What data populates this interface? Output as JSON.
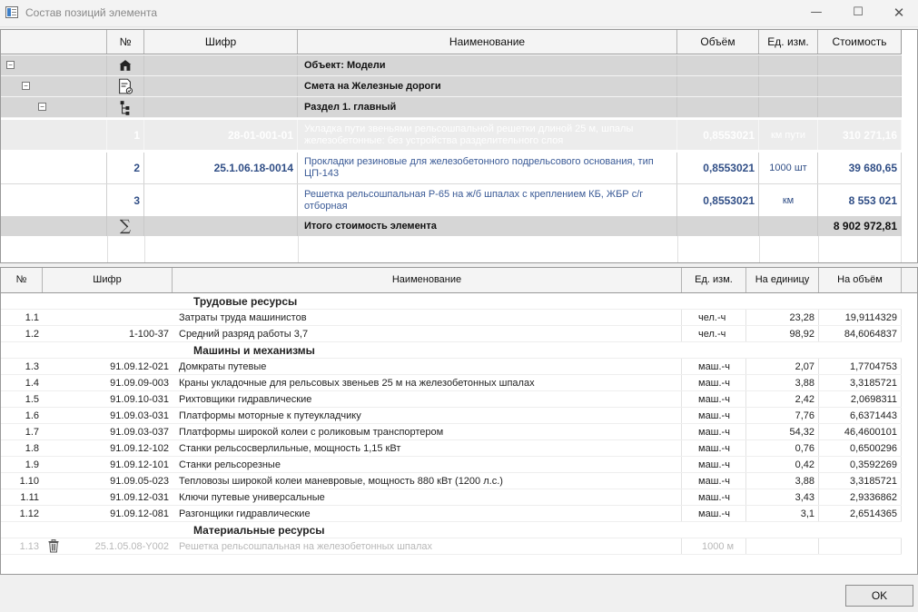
{
  "window": {
    "title": "Состав позиций элемента",
    "minimize": "—",
    "maximize": "☐",
    "close": "✕"
  },
  "top_grid": {
    "headers": [
      "№",
      "Шифр",
      "Наименование",
      "Объём",
      "Ед. изм.",
      "Стоимость"
    ],
    "tree": [
      {
        "name": "Объект: Модели",
        "icon": "building-icon"
      },
      {
        "name": "Смета на Железные дороги",
        "icon": "estimate-document-icon"
      },
      {
        "name": "Раздел 1. главный",
        "icon": "section-tree-icon"
      }
    ],
    "positions": [
      {
        "num": "1",
        "code": "28-01-001-01",
        "name": "Укладка пути звеньями рельсошпальной решетки длиной 25 м, шпалы железобетонные: без устройства разделительного слоя",
        "volume": "0,8553021",
        "unit": "км пути",
        "cost": "310 271,16",
        "state": "faded"
      },
      {
        "num": "2",
        "code": "25.1.06.18-0014",
        "name": "Прокладки резиновые для железобетонного подрельсового основания, тип ЦП-143",
        "volume": "0,8553021",
        "unit": "1000 шт",
        "cost": "39 680,65",
        "state": "normal"
      },
      {
        "num": "3",
        "code": "",
        "name": "Решетка рельсошпальная Р-65 на ж/б шпалах с креплением КБ, ЖБР с/г отборная",
        "volume": "0,8553021",
        "unit": "км",
        "cost": "8 553 021",
        "state": "normal"
      }
    ],
    "total": {
      "symbol": "∑",
      "name": "Итого стоимость элемента",
      "cost": "8 902 972,81"
    },
    "toggle_symbol": "−"
  },
  "bottom_grid": {
    "headers": [
      "№",
      "Шифр",
      "Наименование",
      "Ед. изм.",
      "На единицу",
      "На объём"
    ],
    "rows": [
      {
        "type": "group",
        "name": "Трудовые ресурсы"
      },
      {
        "type": "item",
        "num": "1.1",
        "code": "",
        "name": "Затраты труда машинистов",
        "unit": "чел.-ч",
        "per_unit": "23,28",
        "per_volume": "19,9114329"
      },
      {
        "type": "item",
        "num": "1.2",
        "code": "1-100-37",
        "name": "Средний разряд работы 3,7",
        "unit": "чел.-ч",
        "per_unit": "98,92",
        "per_volume": "84,6064837"
      },
      {
        "type": "group",
        "name": "Машины и механизмы"
      },
      {
        "type": "item",
        "num": "1.3",
        "code": "91.09.12-021",
        "name": "Домкраты путевые",
        "unit": "маш.-ч",
        "per_unit": "2,07",
        "per_volume": "1,7704753"
      },
      {
        "type": "item",
        "num": "1.4",
        "code": "91.09.09-003",
        "name": "Краны укладочные для рельсовых звеньев 25 м на железобетонных шпалах",
        "unit": "маш.-ч",
        "per_unit": "3,88",
        "per_volume": "3,3185721"
      },
      {
        "type": "item",
        "num": "1.5",
        "code": "91.09.10-031",
        "name": "Рихтовщики гидравлические",
        "unit": "маш.-ч",
        "per_unit": "2,42",
        "per_volume": "2,0698311"
      },
      {
        "type": "item",
        "num": "1.6",
        "code": "91.09.03-031",
        "name": "Платформы моторные к путеукладчику",
        "unit": "маш.-ч",
        "per_unit": "7,76",
        "per_volume": "6,6371443"
      },
      {
        "type": "item",
        "num": "1.7",
        "code": "91.09.03-037",
        "name": "Платформы широкой колеи с роликовым транспортером",
        "unit": "маш.-ч",
        "per_unit": "54,32",
        "per_volume": "46,4600101"
      },
      {
        "type": "item",
        "num": "1.8",
        "code": "91.09.12-102",
        "name": "Станки рельсосверлильные, мощность 1,15 кВт",
        "unit": "маш.-ч",
        "per_unit": "0,76",
        "per_volume": "0,6500296"
      },
      {
        "type": "item",
        "num": "1.9",
        "code": "91.09.12-101",
        "name": "Станки рельсорезные",
        "unit": "маш.-ч",
        "per_unit": "0,42",
        "per_volume": "0,3592269"
      },
      {
        "type": "item",
        "num": "1.10",
        "code": "91.09.05-023",
        "name": "Тепловозы широкой колеи маневровые, мощность 880 кВт (1200 л.с.)",
        "unit": "маш.-ч",
        "per_unit": "3,88",
        "per_volume": "3,3185721"
      },
      {
        "type": "item",
        "num": "1.11",
        "code": "91.09.12-031",
        "name": "Ключи путевые универсальные",
        "unit": "маш.-ч",
        "per_unit": "3,43",
        "per_volume": "2,9336862"
      },
      {
        "type": "item",
        "num": "1.12",
        "code": "91.09.12-081",
        "name": "Разгонщики гидравлические",
        "unit": "маш.-ч",
        "per_unit": "3,1",
        "per_volume": "2,6514365"
      },
      {
        "type": "group",
        "name": "Материальные ресурсы"
      },
      {
        "type": "ghost",
        "num": "1.13",
        "code": "25.1.05.08-Y002",
        "name": "Решетка рельсошпальная на железобетонных шпалах",
        "unit": "1000 м",
        "per_unit": "",
        "per_volume": ""
      }
    ]
  },
  "footer": {
    "ok_label": "OK"
  }
}
